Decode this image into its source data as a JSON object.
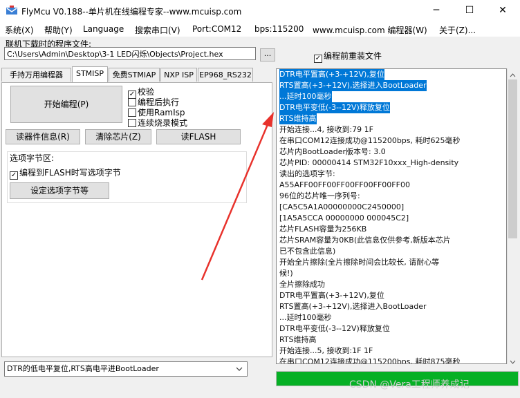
{
  "window": {
    "title": "FlyMcu V0.188--单片机在线编程专家--www.mcuisp.com",
    "buttons": {
      "minimize": "─",
      "maximize": "☐",
      "close": "✕"
    }
  },
  "menu": [
    "系统(X)",
    "帮助(Y)",
    "Language",
    "搜索串口(V)",
    "Port:COM12",
    "bps:115200",
    "www.mcuisp.com 编程器(W)",
    "关于(Z)..."
  ],
  "file": {
    "label": "联机下载时的程序文件:",
    "path": "C:\\Users\\Admin\\Desktop\\3-1 LED闪烁\\Objects\\Project.hex",
    "browse": "...",
    "reload_label": "编程前重装文件",
    "reload_checked": true
  },
  "tabs": [
    "手持万用编程器",
    "STMISP",
    "免费STMIAP",
    "NXP ISP",
    "EP968_RS232"
  ],
  "isp": {
    "start_button": "开始编程(P)",
    "options": [
      {
        "label": "校验",
        "checked": true
      },
      {
        "label": "编程后执行",
        "checked": false
      },
      {
        "label": "使用RamIsp",
        "checked": false
      },
      {
        "label": "连续烧录模式",
        "checked": false
      }
    ],
    "read_info_button": "读器件信息(R)",
    "erase_button": "清除芯片(Z)",
    "read_flash_button": "读FLASH"
  },
  "option_bytes": {
    "group_title": "选项字节区:",
    "write_label": "编程到FLASH时写选项字节",
    "write_checked": true,
    "set_button": "设定选项字节等"
  },
  "reset_mode": "DTR的低电平复位,RTS高电平进BootLoader",
  "log": {
    "lines": [
      {
        "text": "DTR电平置高(+3-+12V),复位",
        "selected": true
      },
      {
        "text": "RTS置高(+3-+12V),选择进入BootLoader",
        "selected": true
      },
      {
        "text": "...延时100毫秒",
        "selected": true
      },
      {
        "text": "DTR电平变低(-3--12V)释放复位",
        "selected": true
      },
      {
        "text": "RTS维持高",
        "selected": true
      },
      {
        "text": "开始连接...4, 接收到:79 1F",
        "selected": false
      },
      {
        "text": "在串口COM12连接成功@115200bps, 耗时625毫秒",
        "selected": false
      },
      {
        "text": "芯片内BootLoader版本号: 3.0",
        "selected": false
      },
      {
        "text": "芯片PID: 00000414  STM32F10xxx_High-density",
        "selected": false
      },
      {
        "text": "读出的选项字节:",
        "selected": false
      },
      {
        "text": "A55AFF00FF00FF00FF00FF00FF00",
        "selected": false
      },
      {
        "text": "96位的芯片唯一序列号:",
        "selected": false
      },
      {
        "text": "[CA5C5A1A00000000C2450000]",
        "selected": false
      },
      {
        "text": "[1A5A5CCA 00000000 000045C2]",
        "selected": false
      },
      {
        "text": "芯片FLASH容量为256KB",
        "selected": false
      },
      {
        "text": "芯片SRAM容量为0KB(此信息仅供参考,新版本芯片",
        "selected": false
      },
      {
        "text": "已不包含此信息)",
        "selected": false
      },
      {
        "text": "开始全片擦除(全片擦除时间会比较长, 请耐心等",
        "selected": false
      },
      {
        "text": "候!)",
        "selected": false
      },
      {
        "text": "全片擦除成功",
        "selected": false
      },
      {
        "text": "DTR电平置高(+3-+12V),复位",
        "selected": false
      },
      {
        "text": "RTS置高(+3-+12V),选择进入BootLoader",
        "selected": false
      },
      {
        "text": "...延时100毫秒",
        "selected": false
      },
      {
        "text": "DTR电平变低(-3--12V)释放复位",
        "selected": false
      },
      {
        "text": "RTS维持高",
        "selected": false
      },
      {
        "text": "开始连接...5, 接收到:1F 1F",
        "selected": false
      },
      {
        "text": "在串口COM12连接成功@115200bps, 耗时875毫秒",
        "selected": false
      }
    ]
  },
  "progress": {
    "fraction": 1.0,
    "color": "#06b025"
  },
  "watermark": "CSDN @Vera工程师养成记",
  "colors": {
    "selection": "#0078d7",
    "annotation_arrow": "#e8322c"
  }
}
